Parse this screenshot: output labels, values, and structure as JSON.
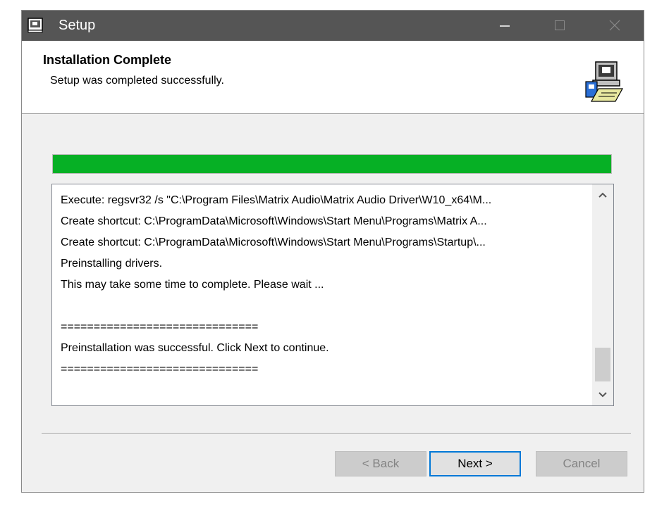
{
  "window": {
    "title": "Setup"
  },
  "header": {
    "heading": "Installation Complete",
    "subheading": "Setup was completed successfully."
  },
  "progress": {
    "percent": 100,
    "color": "#06b025"
  },
  "log": {
    "lines": [
      "Execute: regsvr32 /s \"C:\\Program Files\\Matrix Audio\\Matrix Audio Driver\\W10_x64\\M...",
      "Create shortcut: C:\\ProgramData\\Microsoft\\Windows\\Start Menu\\Programs\\Matrix A...",
      "Create shortcut: C:\\ProgramData\\Microsoft\\Windows\\Start Menu\\Programs\\Startup\\...",
      "Preinstalling drivers.",
      "This may take some time to complete. Please wait ...",
      "",
      "==============================",
      "Preinstallation was successful. Click Next to continue.",
      "=============================="
    ]
  },
  "buttons": {
    "back": "< Back",
    "next": "Next >",
    "cancel": "Cancel"
  },
  "colors": {
    "titlebar": "#555555",
    "accent": "#0078d7"
  }
}
